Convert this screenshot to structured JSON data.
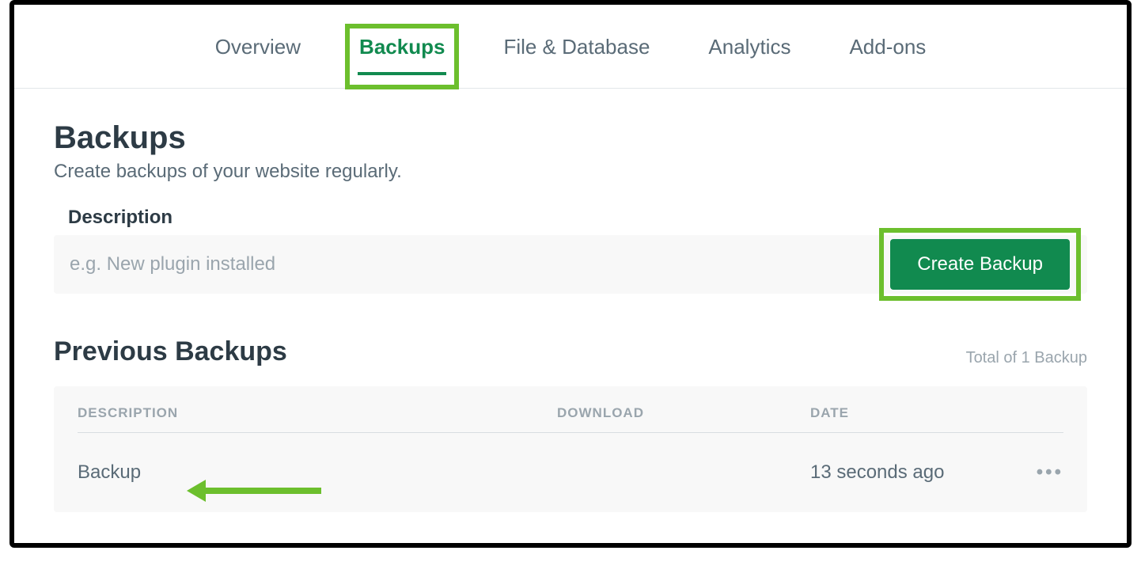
{
  "nav": {
    "items": [
      {
        "label": "Overview",
        "active": false
      },
      {
        "label": "Backups",
        "active": true
      },
      {
        "label": "File & Database",
        "active": false
      },
      {
        "label": "Analytics",
        "active": false
      },
      {
        "label": "Add-ons",
        "active": false
      }
    ]
  },
  "page": {
    "title": "Backups",
    "subtitle": "Create backups of your website regularly."
  },
  "form": {
    "description_label": "Description",
    "description_placeholder": "e.g. New plugin installed",
    "create_button": "Create Backup"
  },
  "previous": {
    "title": "Previous Backups",
    "total": "Total of 1 Backup",
    "columns": {
      "description": "DESCRIPTION",
      "download": "DOWNLOAD",
      "date": "DATE"
    },
    "rows": [
      {
        "description": "Backup",
        "download": "",
        "date": "13 seconds ago"
      }
    ]
  }
}
